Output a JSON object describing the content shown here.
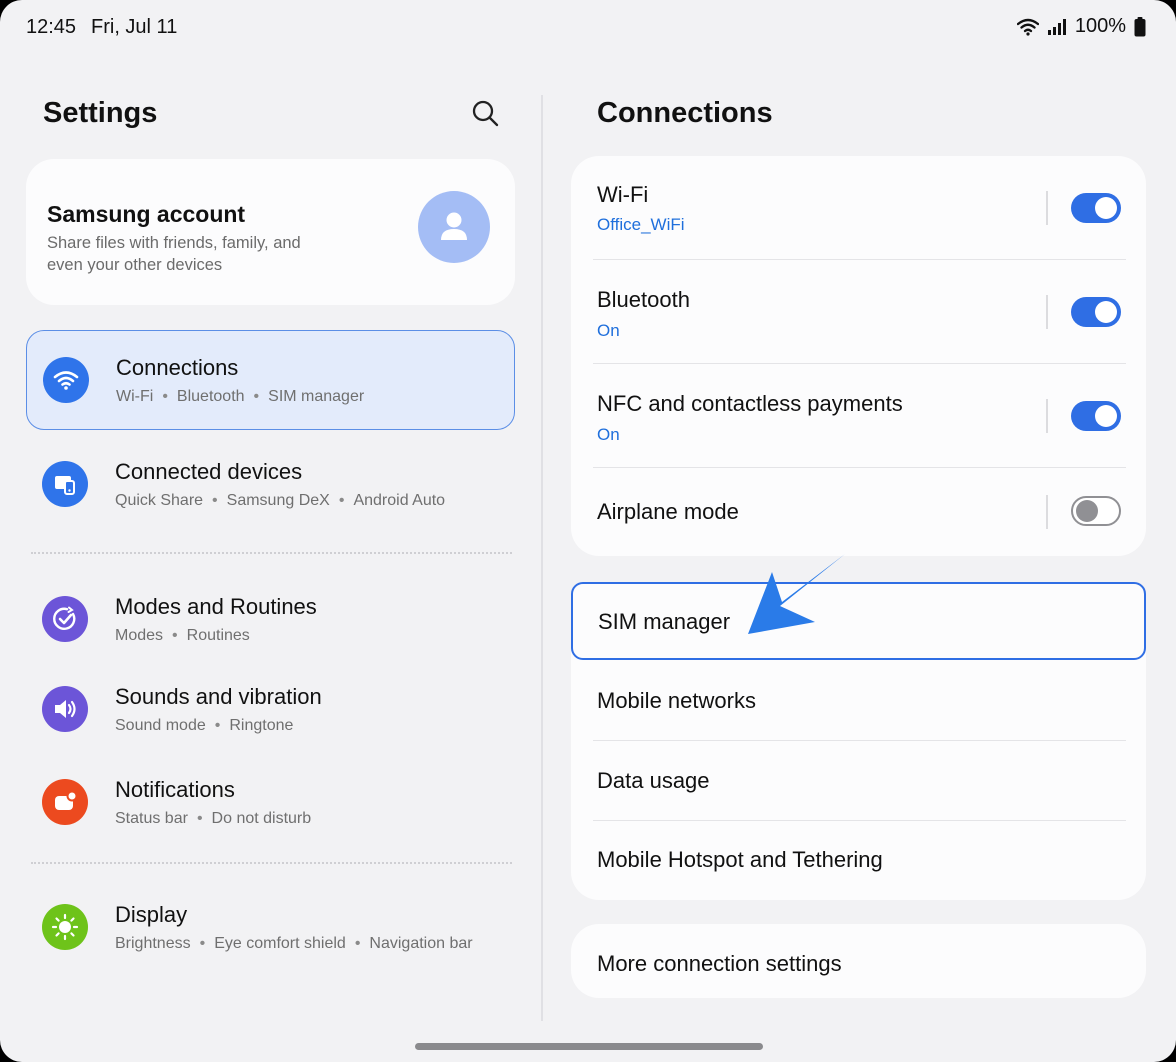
{
  "status_bar": {
    "time": "12:45",
    "date": "Fri, Jul 11",
    "battery": "100%"
  },
  "left_pane": {
    "title": "Settings",
    "account": {
      "title": "Samsung account",
      "subtitle": "Share files with friends, family, and even your other devices"
    },
    "items": [
      {
        "label": "Connections",
        "sub": [
          "Wi-Fi",
          "Bluetooth",
          "SIM manager"
        ],
        "icon": "wifi-icon",
        "color": "#2f74ea",
        "selected": true
      },
      {
        "label": "Connected devices",
        "sub": [
          "Quick Share",
          "Samsung DeX",
          "Android Auto"
        ],
        "icon": "devices-icon",
        "color": "#2f74ea"
      },
      {
        "label": "Modes and Routines",
        "sub": [
          "Modes",
          "Routines"
        ],
        "icon": "check-circle-icon",
        "color": "#6c55d8"
      },
      {
        "label": "Sounds and vibration",
        "sub": [
          "Sound mode",
          "Ringtone"
        ],
        "icon": "speaker-icon",
        "color": "#6c55d8"
      },
      {
        "label": "Notifications",
        "sub": [
          "Status bar",
          "Do not disturb"
        ],
        "icon": "notification-icon",
        "color": "#ec4a1f"
      },
      {
        "label": "Display",
        "sub": [
          "Brightness",
          "Eye comfort shield",
          "Navigation bar"
        ],
        "icon": "sun-icon",
        "color": "#6ec31a"
      }
    ]
  },
  "right_pane": {
    "title": "Connections",
    "toggles": [
      {
        "label": "Wi-Fi",
        "sub": "Office_WiFi",
        "on": true
      },
      {
        "label": "Bluetooth",
        "sub": "On",
        "on": true
      },
      {
        "label": "NFC and contactless payments",
        "sub": "On",
        "on": true
      },
      {
        "label": "Airplane mode",
        "sub": "",
        "on": false
      }
    ],
    "sim_manager": "SIM manager",
    "network_items": [
      "Mobile networks",
      "Data usage",
      "Mobile Hotspot and Tethering"
    ],
    "more": "More connection settings"
  },
  "colors": {
    "accent": "#2f6ee4",
    "link": "#1f6fdc",
    "selected_bg": "#e3ebfb"
  }
}
